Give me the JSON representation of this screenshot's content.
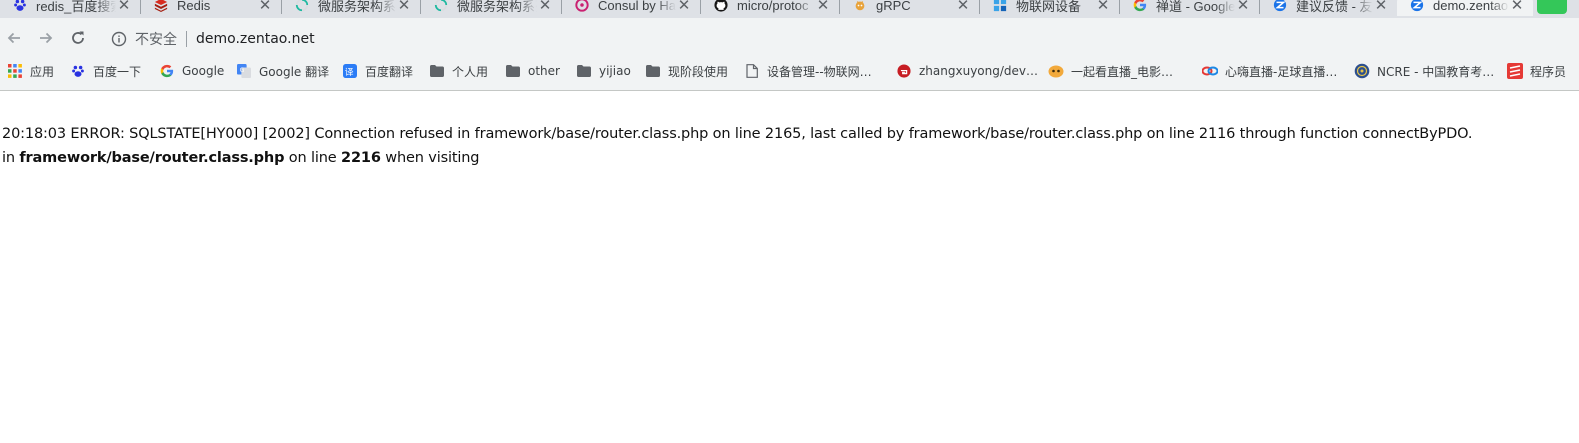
{
  "tabs": [
    {
      "title": "redis_百度搜索",
      "icon": "baidu-paw-icon"
    },
    {
      "title": "Redis",
      "icon": "redis-cube-icon"
    },
    {
      "title": "微服务架构系列",
      "icon": "loading-spinner-icon"
    },
    {
      "title": "微服务架构系列",
      "icon": "loading-spinner-icon"
    },
    {
      "title": "Consul by HashiCorp",
      "icon": "consul-icon"
    },
    {
      "title": "micro/protoc",
      "icon": "github-icon"
    },
    {
      "title": "gRPC",
      "icon": "grpc-icon"
    },
    {
      "title": "物联网设备",
      "icon": "iot-icon"
    },
    {
      "title": "禅道 - Google",
      "icon": "google-g-icon"
    },
    {
      "title": "建议反馈 - 友",
      "icon": "zentao-icon"
    },
    {
      "title": "demo.zentao",
      "icon": "zentao-icon",
      "active": true
    }
  ],
  "toolbar": {
    "security_label": "不安全",
    "url": "demo.zentao.net"
  },
  "bookmarks": [
    {
      "label": "应用",
      "icon": "apps-grid-icon"
    },
    {
      "label": "百度一下",
      "icon": "baidu-paw-icon"
    },
    {
      "label": "Google",
      "icon": "google-g-icon"
    },
    {
      "label": "Google 翻译",
      "icon": "google-translate-icon"
    },
    {
      "label": "百度翻译",
      "icon": "baidu-translate-icon"
    },
    {
      "label": "个人用",
      "icon": "folder-icon"
    },
    {
      "label": "other",
      "icon": "folder-icon"
    },
    {
      "label": "yijiao",
      "icon": "folder-icon"
    },
    {
      "label": "现阶段使用",
      "icon": "folder-icon"
    },
    {
      "label": "设备管理--物联网…",
      "icon": "page-icon"
    },
    {
      "label": "zhangxuyong/dev…",
      "icon": "gitee-icon"
    },
    {
      "label": "一起看直播_电影…",
      "icon": "live-icon"
    },
    {
      "label": "心嗨直播-足球直播…",
      "icon": "xinhai-icon"
    },
    {
      "label": "NCRE - 中国教育考…",
      "icon": "ncre-icon"
    },
    {
      "label": "程序员",
      "icon": "coder-icon"
    }
  ],
  "error": {
    "line1": "20:18:03 ERROR: SQLSTATE[HY000] [2002] Connection refused in framework/base/router.class.php on line 2165, last called by framework/base/router.class.php on line 2116 through function connectByPDO.",
    "line2_prefix": "in ",
    "line2_file": "framework/base/router.class.php",
    "line2_mid": " on line ",
    "line2_line": "2216",
    "line2_suffix": " when visiting"
  },
  "colors": {
    "chrome_bg": "#f1f3f4",
    "tabstrip_bg": "#dee1e6",
    "accent": "#1a73e8"
  }
}
